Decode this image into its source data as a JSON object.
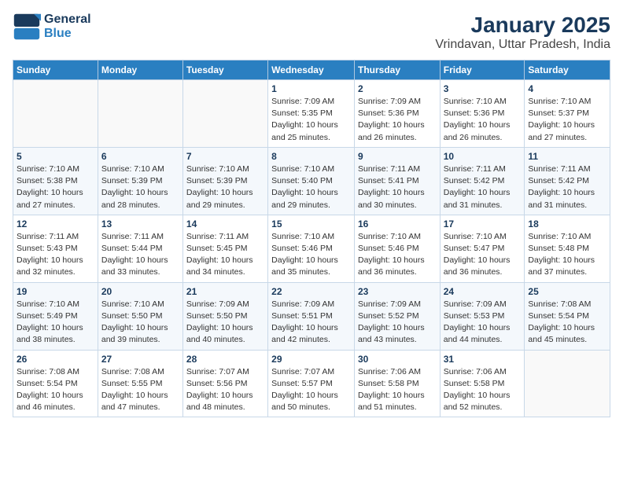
{
  "logo": {
    "line1": "General",
    "line2": "Blue"
  },
  "title": "January 2025",
  "subtitle": "Vrindavan, Uttar Pradesh, India",
  "days_of_week": [
    "Sunday",
    "Monday",
    "Tuesday",
    "Wednesday",
    "Thursday",
    "Friday",
    "Saturday"
  ],
  "weeks": [
    [
      {
        "day": "",
        "info": ""
      },
      {
        "day": "",
        "info": ""
      },
      {
        "day": "",
        "info": ""
      },
      {
        "day": "1",
        "info": "Sunrise: 7:09 AM\nSunset: 5:35 PM\nDaylight: 10 hours\nand 25 minutes."
      },
      {
        "day": "2",
        "info": "Sunrise: 7:09 AM\nSunset: 5:36 PM\nDaylight: 10 hours\nand 26 minutes."
      },
      {
        "day": "3",
        "info": "Sunrise: 7:10 AM\nSunset: 5:36 PM\nDaylight: 10 hours\nand 26 minutes."
      },
      {
        "day": "4",
        "info": "Sunrise: 7:10 AM\nSunset: 5:37 PM\nDaylight: 10 hours\nand 27 minutes."
      }
    ],
    [
      {
        "day": "5",
        "info": "Sunrise: 7:10 AM\nSunset: 5:38 PM\nDaylight: 10 hours\nand 27 minutes."
      },
      {
        "day": "6",
        "info": "Sunrise: 7:10 AM\nSunset: 5:39 PM\nDaylight: 10 hours\nand 28 minutes."
      },
      {
        "day": "7",
        "info": "Sunrise: 7:10 AM\nSunset: 5:39 PM\nDaylight: 10 hours\nand 29 minutes."
      },
      {
        "day": "8",
        "info": "Sunrise: 7:10 AM\nSunset: 5:40 PM\nDaylight: 10 hours\nand 29 minutes."
      },
      {
        "day": "9",
        "info": "Sunrise: 7:11 AM\nSunset: 5:41 PM\nDaylight: 10 hours\nand 30 minutes."
      },
      {
        "day": "10",
        "info": "Sunrise: 7:11 AM\nSunset: 5:42 PM\nDaylight: 10 hours\nand 31 minutes."
      },
      {
        "day": "11",
        "info": "Sunrise: 7:11 AM\nSunset: 5:42 PM\nDaylight: 10 hours\nand 31 minutes."
      }
    ],
    [
      {
        "day": "12",
        "info": "Sunrise: 7:11 AM\nSunset: 5:43 PM\nDaylight: 10 hours\nand 32 minutes."
      },
      {
        "day": "13",
        "info": "Sunrise: 7:11 AM\nSunset: 5:44 PM\nDaylight: 10 hours\nand 33 minutes."
      },
      {
        "day": "14",
        "info": "Sunrise: 7:11 AM\nSunset: 5:45 PM\nDaylight: 10 hours\nand 34 minutes."
      },
      {
        "day": "15",
        "info": "Sunrise: 7:10 AM\nSunset: 5:46 PM\nDaylight: 10 hours\nand 35 minutes."
      },
      {
        "day": "16",
        "info": "Sunrise: 7:10 AM\nSunset: 5:46 PM\nDaylight: 10 hours\nand 36 minutes."
      },
      {
        "day": "17",
        "info": "Sunrise: 7:10 AM\nSunset: 5:47 PM\nDaylight: 10 hours\nand 36 minutes."
      },
      {
        "day": "18",
        "info": "Sunrise: 7:10 AM\nSunset: 5:48 PM\nDaylight: 10 hours\nand 37 minutes."
      }
    ],
    [
      {
        "day": "19",
        "info": "Sunrise: 7:10 AM\nSunset: 5:49 PM\nDaylight: 10 hours\nand 38 minutes."
      },
      {
        "day": "20",
        "info": "Sunrise: 7:10 AM\nSunset: 5:50 PM\nDaylight: 10 hours\nand 39 minutes."
      },
      {
        "day": "21",
        "info": "Sunrise: 7:09 AM\nSunset: 5:50 PM\nDaylight: 10 hours\nand 40 minutes."
      },
      {
        "day": "22",
        "info": "Sunrise: 7:09 AM\nSunset: 5:51 PM\nDaylight: 10 hours\nand 42 minutes."
      },
      {
        "day": "23",
        "info": "Sunrise: 7:09 AM\nSunset: 5:52 PM\nDaylight: 10 hours\nand 43 minutes."
      },
      {
        "day": "24",
        "info": "Sunrise: 7:09 AM\nSunset: 5:53 PM\nDaylight: 10 hours\nand 44 minutes."
      },
      {
        "day": "25",
        "info": "Sunrise: 7:08 AM\nSunset: 5:54 PM\nDaylight: 10 hours\nand 45 minutes."
      }
    ],
    [
      {
        "day": "26",
        "info": "Sunrise: 7:08 AM\nSunset: 5:54 PM\nDaylight: 10 hours\nand 46 minutes."
      },
      {
        "day": "27",
        "info": "Sunrise: 7:08 AM\nSunset: 5:55 PM\nDaylight: 10 hours\nand 47 minutes."
      },
      {
        "day": "28",
        "info": "Sunrise: 7:07 AM\nSunset: 5:56 PM\nDaylight: 10 hours\nand 48 minutes."
      },
      {
        "day": "29",
        "info": "Sunrise: 7:07 AM\nSunset: 5:57 PM\nDaylight: 10 hours\nand 50 minutes."
      },
      {
        "day": "30",
        "info": "Sunrise: 7:06 AM\nSunset: 5:58 PM\nDaylight: 10 hours\nand 51 minutes."
      },
      {
        "day": "31",
        "info": "Sunrise: 7:06 AM\nSunset: 5:58 PM\nDaylight: 10 hours\nand 52 minutes."
      },
      {
        "day": "",
        "info": ""
      }
    ]
  ]
}
